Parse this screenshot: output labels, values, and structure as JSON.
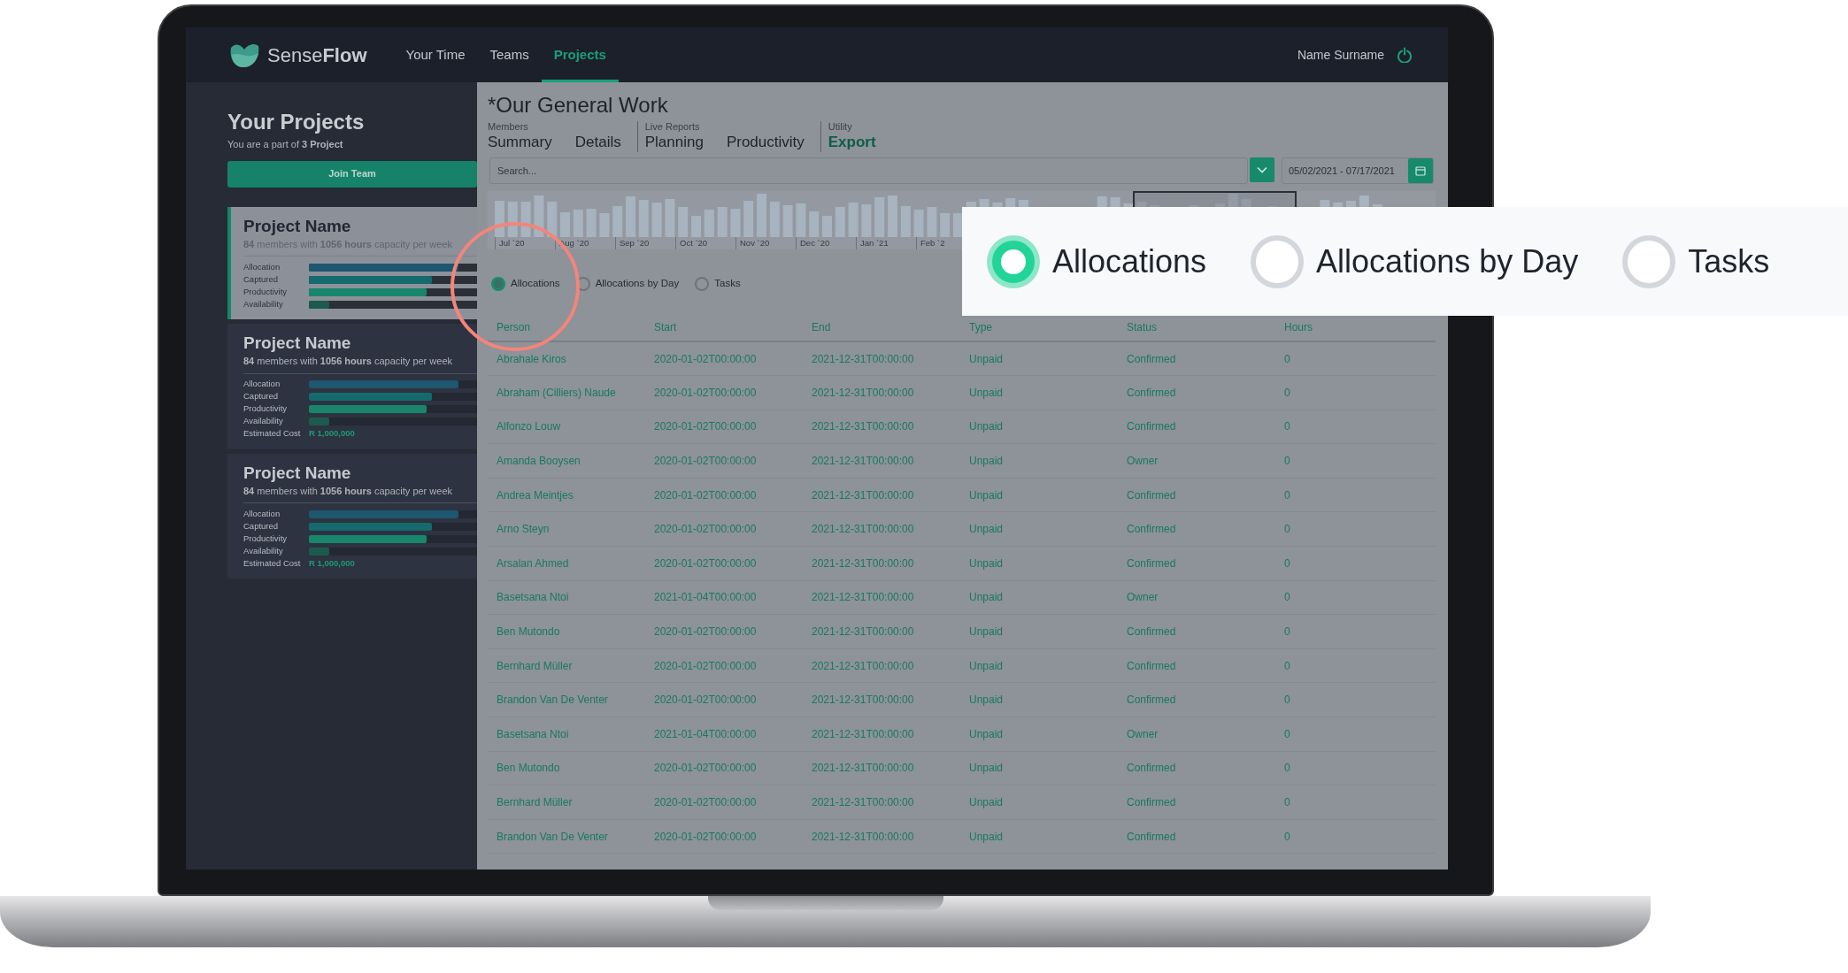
{
  "header": {
    "brand": "Sense**Flow**",
    "nav": [
      {
        "label": "Your Time",
        "selected": false
      },
      {
        "label": "Teams",
        "selected": false
      },
      {
        "label": "Projects",
        "selected": true
      }
    ],
    "user": "Name Surname"
  },
  "sidebar": {
    "title": "Your Projects",
    "subtitle": "You are a part of **3 Project**",
    "join_button": "Join Team",
    "projects": [
      {
        "name": "Project Name",
        "summary": "**84** members with **1056 hours** capacity per week",
        "selected": true,
        "metrics": [
          {
            "label": "Allocation",
            "level": 0.89,
            "color": "#1f5670"
          },
          {
            "label": "Captured",
            "level": 0.73,
            "color": "#146a6c"
          },
          {
            "label": "Productivity",
            "level": 0.7,
            "color": "#17866c"
          },
          {
            "label": "Availability",
            "level": 0.12,
            "color": "#1d5a4e"
          }
        ]
      },
      {
        "name": "Project Name",
        "summary": "**84** members with **1056 hours** capacity per week",
        "selected": false,
        "metrics": [
          {
            "label": "Allocation",
            "level": 0.89,
            "color": "#1f5670"
          },
          {
            "label": "Captured",
            "level": 0.73,
            "color": "#146a6c"
          },
          {
            "label": "Productivity",
            "level": 0.7,
            "color": "#17866c"
          },
          {
            "label": "Availability",
            "level": 0.12,
            "color": "#1d5a4e"
          }
        ],
        "cost_label": "Estimated Cost",
        "cost": "R 1,000,000"
      },
      {
        "name": "Project Name",
        "summary": "**84** members with **1056 hours** capacity per week",
        "selected": false,
        "metrics": [
          {
            "label": "Allocation",
            "level": 0.89,
            "color": "#1f5670"
          },
          {
            "label": "Captured",
            "level": 0.73,
            "color": "#146a6c"
          },
          {
            "label": "Productivity",
            "level": 0.7,
            "color": "#17866c"
          },
          {
            "label": "Availability",
            "level": 0.12,
            "color": "#1d5a4e"
          }
        ],
        "cost_label": "Estimated Cost",
        "cost": "R 1,000,000"
      }
    ]
  },
  "main": {
    "title": "*Our General Work",
    "tab_groups": [
      {
        "label": "Members",
        "tabs": [
          {
            "label": "Summary",
            "selected": false
          },
          {
            "label": "Details",
            "selected": false
          }
        ]
      },
      {
        "label": "Live Reports",
        "tabs": [
          {
            "label": "Planning",
            "selected": false
          },
          {
            "label": "Productivity",
            "selected": false
          }
        ]
      },
      {
        "label": "Utility",
        "tabs": [
          {
            "label": "Export",
            "selected": true
          }
        ]
      }
    ],
    "search": {
      "placeholder": "Search..."
    },
    "date_range": "05/02/2021 - 07/17/2021",
    "timeline_labels": [
      "Jul `20",
      "Aug `20",
      "Sep `20",
      "Oct `20",
      "Nov `20",
      "Dec `20",
      "Jan `21",
      "Feb `2"
    ],
    "views": [
      {
        "label": "Allocations",
        "selected": true
      },
      {
        "label": "Allocations by Day",
        "selected": false
      },
      {
        "label": "Tasks",
        "selected": false
      }
    ],
    "table": {
      "columns": [
        "Person",
        "Start",
        "End",
        "Type",
        "Status",
        "Hours"
      ],
      "rows": [
        [
          "Abrahale Kiros",
          "2020-01-02T00:00:00",
          "2021-12-31T00:00:00",
          "Unpaid",
          "Confirmed",
          "0"
        ],
        [
          "Abraham (Cilliers) Naude",
          "2020-01-02T00:00:00",
          "2021-12-31T00:00:00",
          "Unpaid",
          "Confirmed",
          "0"
        ],
        [
          "Alfonzo Louw",
          "2020-01-02T00:00:00",
          "2021-12-31T00:00:00",
          "Unpaid",
          "Confirmed",
          "0"
        ],
        [
          "Amanda Booysen",
          "2020-01-02T00:00:00",
          "2021-12-31T00:00:00",
          "Unpaid",
          "Owner",
          "0"
        ],
        [
          "Andrea Meintjes",
          "2020-01-02T00:00:00",
          "2021-12-31T00:00:00",
          "Unpaid",
          "Confirmed",
          "0"
        ],
        [
          "Arno Steyn",
          "2020-01-02T00:00:00",
          "2021-12-31T00:00:00",
          "Unpaid",
          "Confirmed",
          "0"
        ],
        [
          "Arsalan Ahmed",
          "2020-01-02T00:00:00",
          "2021-12-31T00:00:00",
          "Unpaid",
          "Confirmed",
          "0"
        ],
        [
          "Basetsana Ntoi",
          "2021-01-04T00:00:00",
          "2021-12-31T00:00:00",
          "Unpaid",
          "Owner",
          "0"
        ],
        [
          "Ben Mutondo",
          "2020-01-02T00:00:00",
          "2021-12-31T00:00:00",
          "Unpaid",
          "Confirmed",
          "0"
        ],
        [
          "Bernhard Müller",
          "2020-01-02T00:00:00",
          "2021-12-31T00:00:00",
          "Unpaid",
          "Confirmed",
          "0"
        ],
        [
          "Brandon Van De Venter",
          "2020-01-02T00:00:00",
          "2021-12-31T00:00:00",
          "Unpaid",
          "Confirmed",
          "0"
        ],
        [
          "Basetsana Ntoi",
          "2021-01-04T00:00:00",
          "2021-12-31T00:00:00",
          "Unpaid",
          "Owner",
          "0"
        ],
        [
          "Ben Mutondo",
          "2020-01-02T00:00:00",
          "2021-12-31T00:00:00",
          "Unpaid",
          "Confirmed",
          "0"
        ],
        [
          "Bernhard Müller",
          "2020-01-02T00:00:00",
          "2021-12-31T00:00:00",
          "Unpaid",
          "Confirmed",
          "0"
        ],
        [
          "Brandon Van De Venter",
          "2020-01-02T00:00:00",
          "2021-12-31T00:00:00",
          "Unpaid",
          "Confirmed",
          "0"
        ]
      ]
    }
  },
  "callout": {
    "views": [
      {
        "label": "Allocations",
        "selected": true
      },
      {
        "label": "Allocations by Day",
        "selected": false
      },
      {
        "label": "Tasks",
        "selected": false
      }
    ]
  }
}
